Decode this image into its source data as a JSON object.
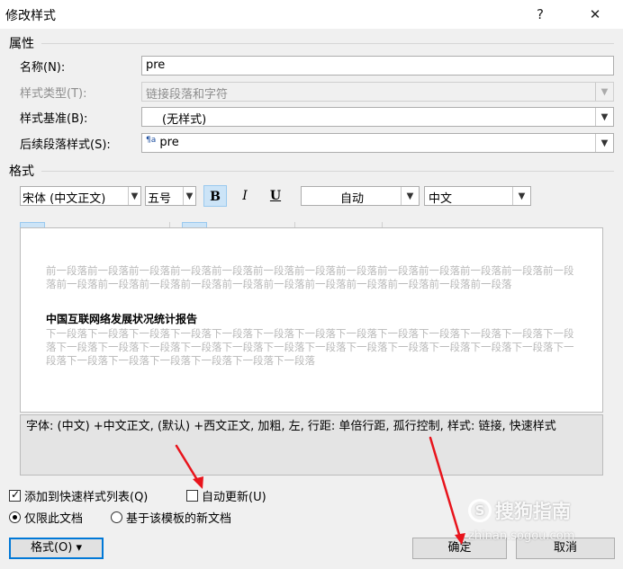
{
  "window": {
    "title": "修改样式",
    "help": "?",
    "close": "✕"
  },
  "properties": {
    "section": "属性",
    "name_label": "名称(N):",
    "name_value": "pre",
    "type_label": "样式类型(T):",
    "type_value": "链接段落和字符",
    "base_label": "样式基准(B):",
    "base_value": "(无样式)",
    "next_label": "后续段落样式(S):",
    "next_value": "pre",
    "next_icon_text": "¶a"
  },
  "format": {
    "section": "格式",
    "font": "宋体 (中文正文)",
    "size": "五号",
    "bold": "B",
    "italic": "I",
    "underline": "U",
    "color": "自动",
    "lang": "中文"
  },
  "preview": {
    "before": "前一段落前一段落前一段落前一段落前一段落前一段落前一段落前一段落前一段落前一段落前一段落前一段落前一段落前一段落前一段落前一段落前一段落前一段落前一段落前一段落前一段落前一段落前一段落前一段落",
    "sample": "中国互联网络发展状况统计报告",
    "after": "下一段落下一段落下一段落下一段落下一段落下一段落下一段落下一段落下一段落下一段落下一段落下一段落下一段落下一段落下一段落下一段落下一段落下一段落下一段落下一段落下一段落下一段落下一段落下一段落下一段落下一段落下一段落下一段落下一段落下一段落下一段落下一段落"
  },
  "description": "字体: (中文) +中文正文, (默认) +西文正文, 加粗, 左, 行距: 单倍行距, 孤行控制, 样式: 链接, 快速样式",
  "options": {
    "add_quick": "添加到快速样式列表(Q)",
    "auto_update": "自动更新(U)",
    "only_doc": "仅限此文档",
    "template_docs": "基于该模板的新文档"
  },
  "buttons": {
    "format": "格式(O)",
    "format_arrow": "▾",
    "ok": "确定",
    "cancel": "取消"
  },
  "watermark": {
    "brand": "搜狗指南",
    "url": "zhinan.sogou.com"
  },
  "colors": {
    "accent": "#0078d7",
    "arrow": "#e8141c",
    "active_btn": "#cce4f7"
  }
}
